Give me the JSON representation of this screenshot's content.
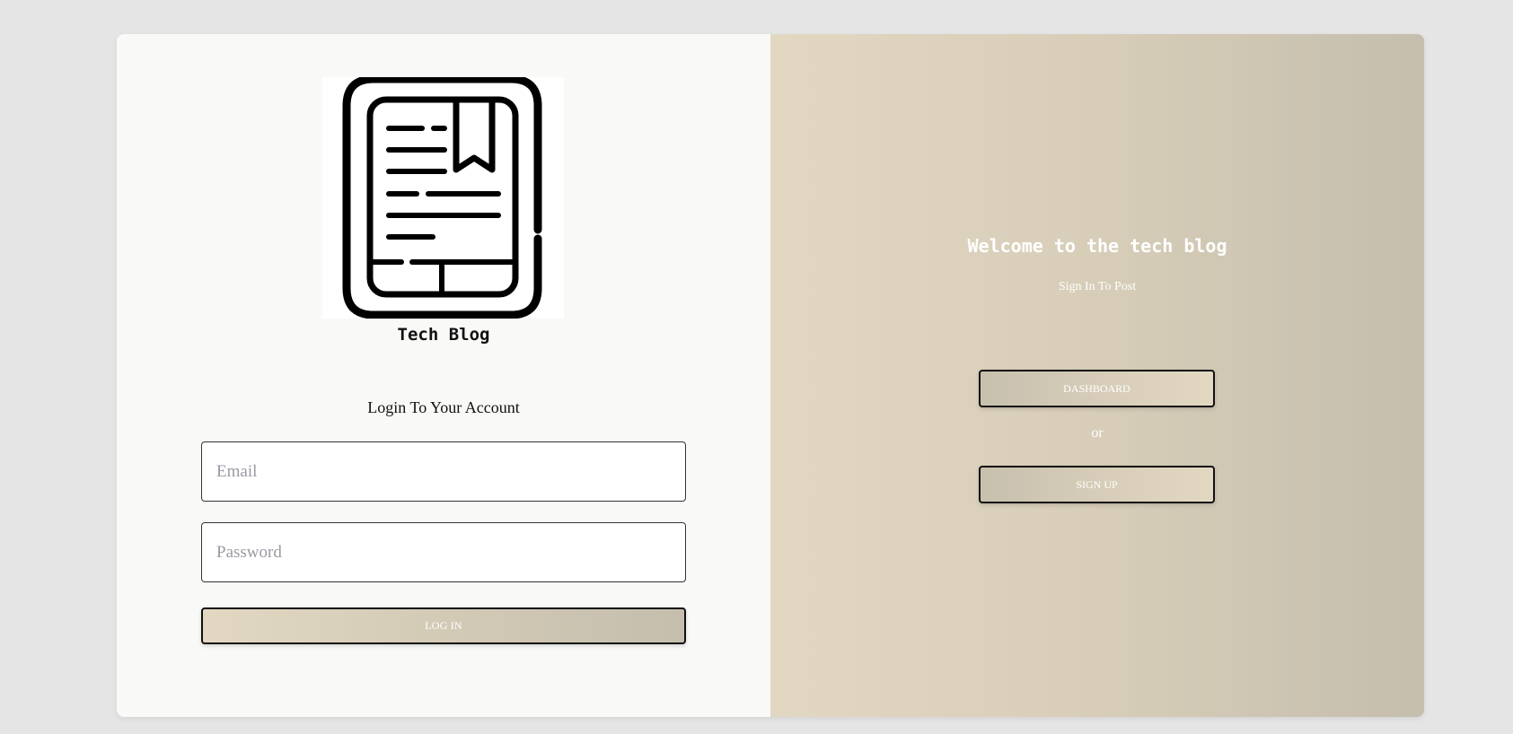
{
  "login_panel": {
    "logo_icon": "ebook-reader-icon",
    "brand_name": "Tech Blog",
    "heading": "Login To Your Account",
    "email_placeholder": "Email",
    "password_placeholder": "Password",
    "login_label": "LOG IN"
  },
  "welcome_panel": {
    "title": "Welcome to the tech blog",
    "subtitle": "Sign In To Post",
    "dashboard_label": "DASHBOARD",
    "or_label": "or",
    "signup_label": "SIGN UP"
  },
  "colors": {
    "page_background": "#e5e5e5",
    "left_panel": "#f9f9f7",
    "gradient_light": "#e2d8c2",
    "gradient_dark": "#c5bead",
    "button_border": "#111111"
  }
}
